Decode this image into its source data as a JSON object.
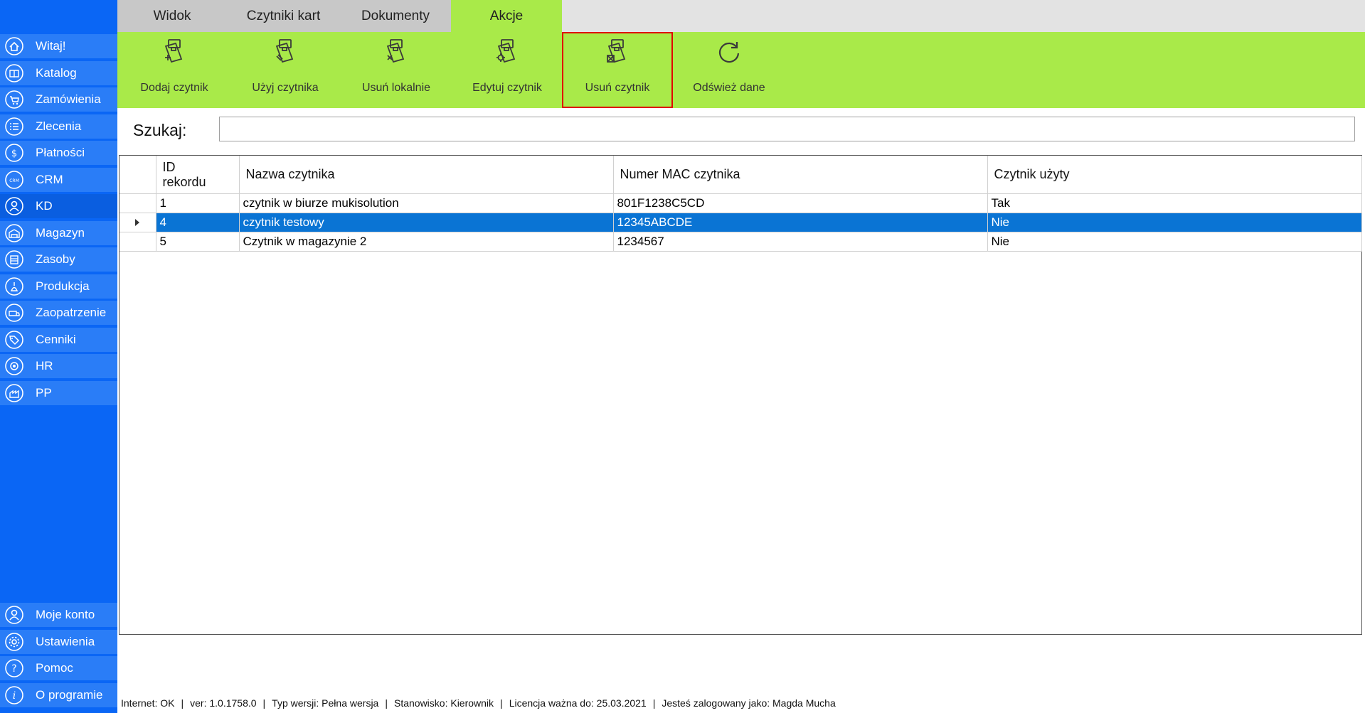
{
  "sidebar": {
    "items": [
      {
        "label": "Witaj!",
        "icon": "home-icon"
      },
      {
        "label": "Katalog",
        "icon": "book-icon"
      },
      {
        "label": "Zamówienia",
        "icon": "cart-icon"
      },
      {
        "label": "Zlecenia",
        "icon": "list-icon"
      },
      {
        "label": "Płatności",
        "icon": "dollar-icon"
      },
      {
        "label": "CRM",
        "icon": "crm-icon"
      },
      {
        "label": "KD",
        "icon": "user-icon"
      },
      {
        "label": "Magazyn",
        "icon": "warehouse-icon"
      },
      {
        "label": "Zasoby",
        "icon": "resources-icon"
      },
      {
        "label": "Produkcja",
        "icon": "production-icon"
      },
      {
        "label": "Zaopatrzenie",
        "icon": "truck-icon"
      },
      {
        "label": "Cenniki",
        "icon": "tag-icon"
      },
      {
        "label": "HR",
        "icon": "hr-icon"
      },
      {
        "label": "PP",
        "icon": "pp-icon"
      }
    ],
    "active_index": 6,
    "bottom_items": [
      {
        "label": "Moje konto",
        "icon": "account-icon"
      },
      {
        "label": "Ustawienia",
        "icon": "gear-icon"
      },
      {
        "label": "Pomoc",
        "icon": "help-icon"
      },
      {
        "label": "O programie",
        "icon": "info-icon"
      }
    ]
  },
  "tabs": [
    {
      "label": "Widok"
    },
    {
      "label": "Czytniki kart"
    },
    {
      "label": "Dokumenty"
    },
    {
      "label": "Akcje"
    }
  ],
  "active_tab": 3,
  "ribbon": {
    "buttons": [
      {
        "label": "Dodaj czytnik",
        "icon": "card-reader-add-icon"
      },
      {
        "label": "Użyj czytnika",
        "icon": "card-reader-use-icon"
      },
      {
        "label": "Usuń lokalnie",
        "icon": "card-reader-remove-local-icon"
      },
      {
        "label": "Edytuj czytnik",
        "icon": "card-reader-edit-icon"
      },
      {
        "label": "Usuń czytnik",
        "icon": "card-reader-delete-icon",
        "highlighted": true
      },
      {
        "label": "Odśwież dane",
        "icon": "refresh-icon"
      }
    ]
  },
  "search": {
    "label": "Szukaj:",
    "value": ""
  },
  "grid": {
    "columns": [
      "ID\nrekordu",
      "Nazwa czytnika",
      "Numer MAC czytnika",
      "Czytnik użyty"
    ],
    "rows": [
      {
        "id": "1",
        "name": "czytnik w biurze mukisolution",
        "mac": "801F1238C5CD",
        "used": "Tak"
      },
      {
        "id": "4",
        "name": "czytnik testowy",
        "mac": "12345ABCDE",
        "used": "Nie",
        "selected": true
      },
      {
        "id": "5",
        "name": "Czytnik w magazynie 2",
        "mac": "1234567",
        "used": "Nie"
      }
    ]
  },
  "status": {
    "internet": "Internet: OK",
    "version": "ver: 1.0.1758.0",
    "type": "Typ wersji: Pełna wersja",
    "role": "Stanowisko: Kierownik",
    "license": "Licencja ważna do: 25.03.2021",
    "user": "Jesteś zalogowany jako: Magda Mucha"
  },
  "colors": {
    "sidebar_bg": "#0a66f5",
    "ribbon_bg": "#a9ea49",
    "selection": "#0a74d4",
    "highlight_border": "#e00000"
  }
}
